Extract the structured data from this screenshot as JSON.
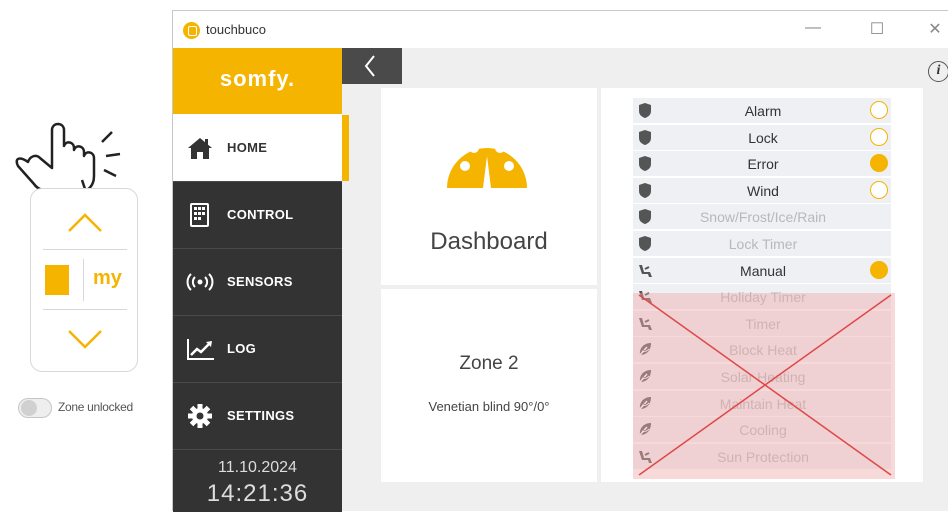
{
  "window": {
    "title": "touchbuco",
    "controls": {
      "minimize": "—",
      "maximize": "☐",
      "close": "✕"
    }
  },
  "remote": {
    "my_label": "my",
    "zone_label": "Zone unlocked",
    "zone_locked": false
  },
  "sidebar": {
    "logo": "somfy.",
    "items": [
      {
        "label": "HOME",
        "icon": "home-icon",
        "active": true
      },
      {
        "label": "CONTROL",
        "icon": "control-icon",
        "active": false
      },
      {
        "label": "SENSORS",
        "icon": "sensors-icon",
        "active": false
      },
      {
        "label": "LOG",
        "icon": "log-icon",
        "active": false
      },
      {
        "label": "SETTINGS",
        "icon": "gear-icon",
        "active": false
      }
    ],
    "date": "11.10.2024",
    "time": "14:21:36"
  },
  "toolbar": {
    "back_icon": "chevron-left-icon",
    "info_icon": "info-icon"
  },
  "dashboard": {
    "title": "Dashboard",
    "icon": "speedometer-icon"
  },
  "zone": {
    "name": "Zone 2",
    "description": "Venetian blind 90°/0°"
  },
  "status": {
    "rows": [
      {
        "label": "Alarm",
        "icon": "shield-icon",
        "indicator": "empty",
        "dim": false
      },
      {
        "label": "Lock",
        "icon": "shield-icon",
        "indicator": "empty",
        "dim": false
      },
      {
        "label": "Error",
        "icon": "shield-icon",
        "indicator": "filled",
        "dim": false
      },
      {
        "label": "Wind",
        "icon": "shield-icon",
        "indicator": "empty",
        "dim": false
      },
      {
        "label": "Snow/Frost/Ice/Rain",
        "icon": "shield-icon",
        "indicator": "none",
        "dim": true
      },
      {
        "label": "Lock Timer",
        "icon": "shield-icon",
        "indicator": "none",
        "dim": true
      },
      {
        "label": "Manual",
        "icon": "chair-icon",
        "indicator": "filled",
        "dim": false
      },
      {
        "label": "Holiday Timer",
        "icon": "chair-icon",
        "indicator": "none",
        "dim": true
      },
      {
        "label": "Timer",
        "icon": "chair-icon",
        "indicator": "none",
        "dim": true
      },
      {
        "label": "Block Heat",
        "icon": "leaf-icon",
        "indicator": "none",
        "dim": true
      },
      {
        "label": "Solar Heating",
        "icon": "leaf-icon",
        "indicator": "none",
        "dim": true
      },
      {
        "label": "Maintain Heat",
        "icon": "leaf-icon",
        "indicator": "none",
        "dim": true
      },
      {
        "label": "Cooling",
        "icon": "leaf-icon",
        "indicator": "none",
        "dim": true
      },
      {
        "label": "Sun Protection",
        "icon": "chair-icon",
        "indicator": "none",
        "dim": true
      }
    ]
  },
  "colors": {
    "accent": "#f5b400",
    "sidebar_dark": "#333333",
    "cross": "#e04848",
    "overlay": "#f0aaaa"
  }
}
